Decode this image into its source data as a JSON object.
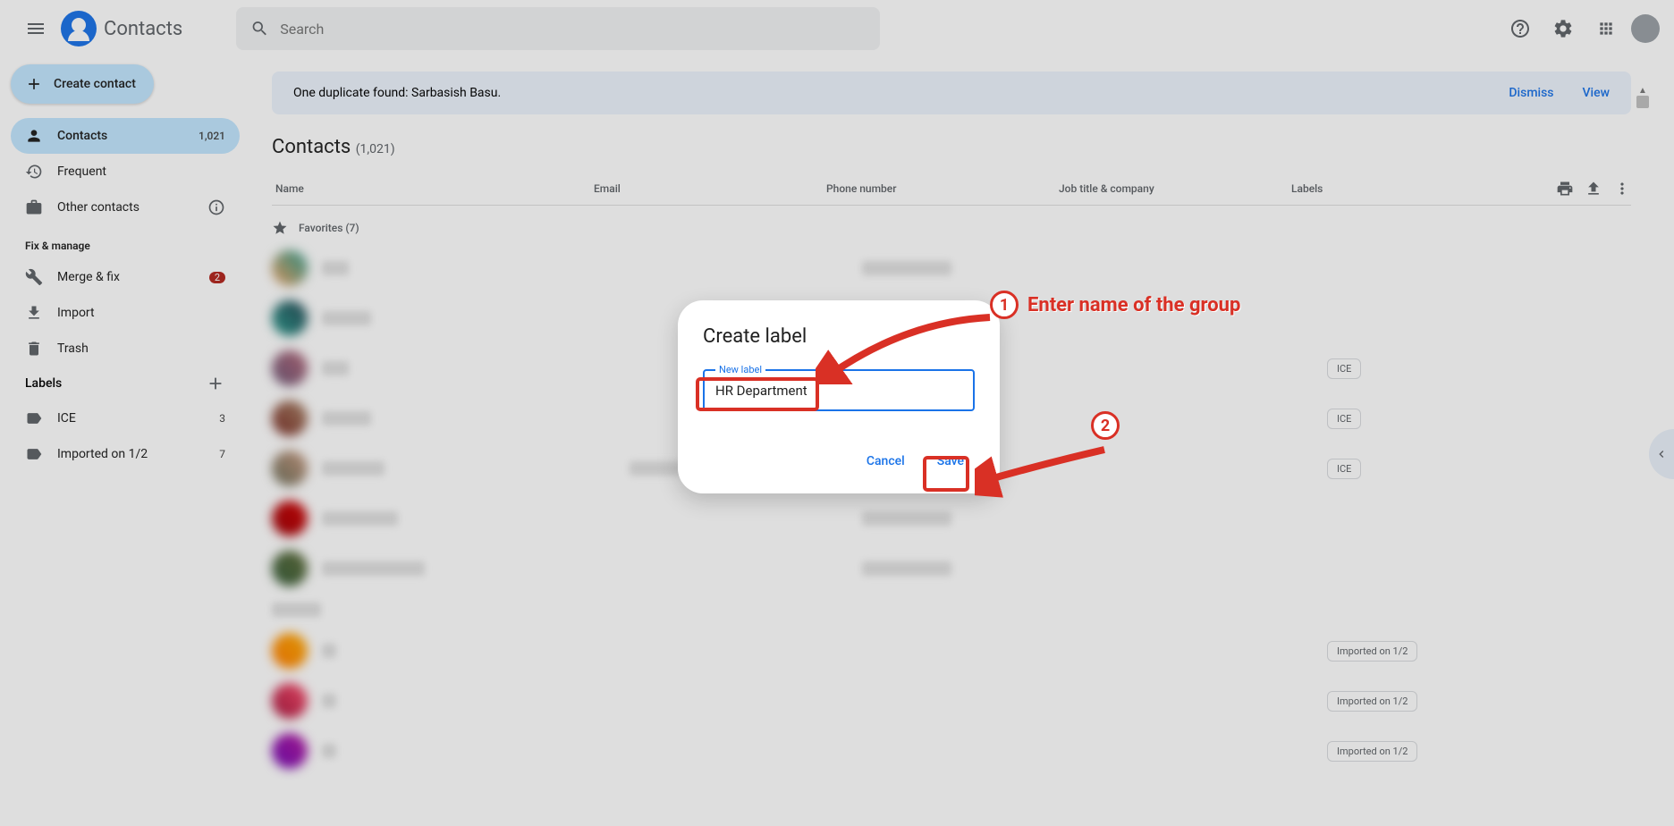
{
  "app": {
    "title": "Contacts"
  },
  "search": {
    "placeholder": "Search"
  },
  "sidebar": {
    "create_label": "Create contact",
    "items": [
      {
        "label": "Contacts",
        "count": "1,021"
      },
      {
        "label": "Frequent"
      },
      {
        "label": "Other contacts"
      }
    ],
    "fix_title": "Fix & manage",
    "fix_items": [
      {
        "label": "Merge & fix",
        "badge": "2"
      },
      {
        "label": "Import"
      },
      {
        "label": "Trash"
      }
    ],
    "labels_title": "Labels",
    "labels": [
      {
        "label": "ICE",
        "count": "3"
      },
      {
        "label": "Imported on 1/2",
        "count": "7"
      }
    ]
  },
  "banner": {
    "message": "One duplicate found: Sarbasish Basu.",
    "dismiss": "Dismiss",
    "view": "View"
  },
  "list": {
    "title": "Contacts",
    "count": "(1,021)",
    "columns": {
      "name": "Name",
      "email": "Email",
      "phone": "Phone number",
      "job": "Job title & company",
      "labels": "Labels"
    },
    "favorites_header": "Favorites (7)"
  },
  "rows": [
    {
      "avatar_bg": "linear-gradient(45deg,#f4a261,#2a9d8f)",
      "name_w": 30,
      "phone_w": 100,
      "labels": []
    },
    {
      "avatar_bg": "linear-gradient(45deg,#2a9d8f,#264653)",
      "name_w": 55,
      "phone_w": 0,
      "labels": []
    },
    {
      "avatar_bg": "linear-gradient(45deg,#6d597a,#b56576)",
      "name_w": 30,
      "phone_w": 0,
      "labels": [
        "ICE"
      ]
    },
    {
      "avatar_bg": "linear-gradient(45deg,#7b2d26,#a98467)",
      "name_w": 55,
      "phone_w": 0,
      "labels": [
        "ICE"
      ]
    },
    {
      "avatar_bg": "linear-gradient(45deg,#6b705c,#cb997e)",
      "name_w": 70,
      "email_w": 60,
      "phone_w": 0,
      "labels": [
        "ICE"
      ]
    },
    {
      "avatar_bg": "linear-gradient(45deg,#9d0208,#d00000)",
      "name_w": 85,
      "phone_w": 100,
      "labels": []
    },
    {
      "avatar_bg": "linear-gradient(45deg,#355e3b,#606c38)",
      "name_w": 115,
      "phone_w": 100,
      "labels": []
    },
    {
      "avatar_bg": "#f8f9fa",
      "section": true,
      "name_w": 55
    },
    {
      "avatar_bg": "linear-gradient(45deg,#ff7b00,#ffaa00)",
      "name_w": 16,
      "phone_w": 0,
      "labels": [
        "Imported on 1/2"
      ]
    },
    {
      "avatar_bg": "linear-gradient(45deg,#a4133c,#ff4d6d)",
      "name_w": 16,
      "phone_w": 0,
      "labels": [
        "Imported on 1/2"
      ]
    },
    {
      "avatar_bg": "linear-gradient(45deg,#7209b7,#b5179e)",
      "name_w": 16,
      "phone_w": 0,
      "labels": [
        "Imported on 1/2"
      ]
    }
  ],
  "chips": {
    "ice": "ICE",
    "imported": "Imported on 1/2"
  },
  "dialog": {
    "title": "Create label",
    "field_label": "New label",
    "field_value": "HR Department",
    "cancel": "Cancel",
    "save": "Save"
  },
  "annotations": {
    "step1": "1",
    "step1_text": "Enter name of the group",
    "step2": "2"
  }
}
